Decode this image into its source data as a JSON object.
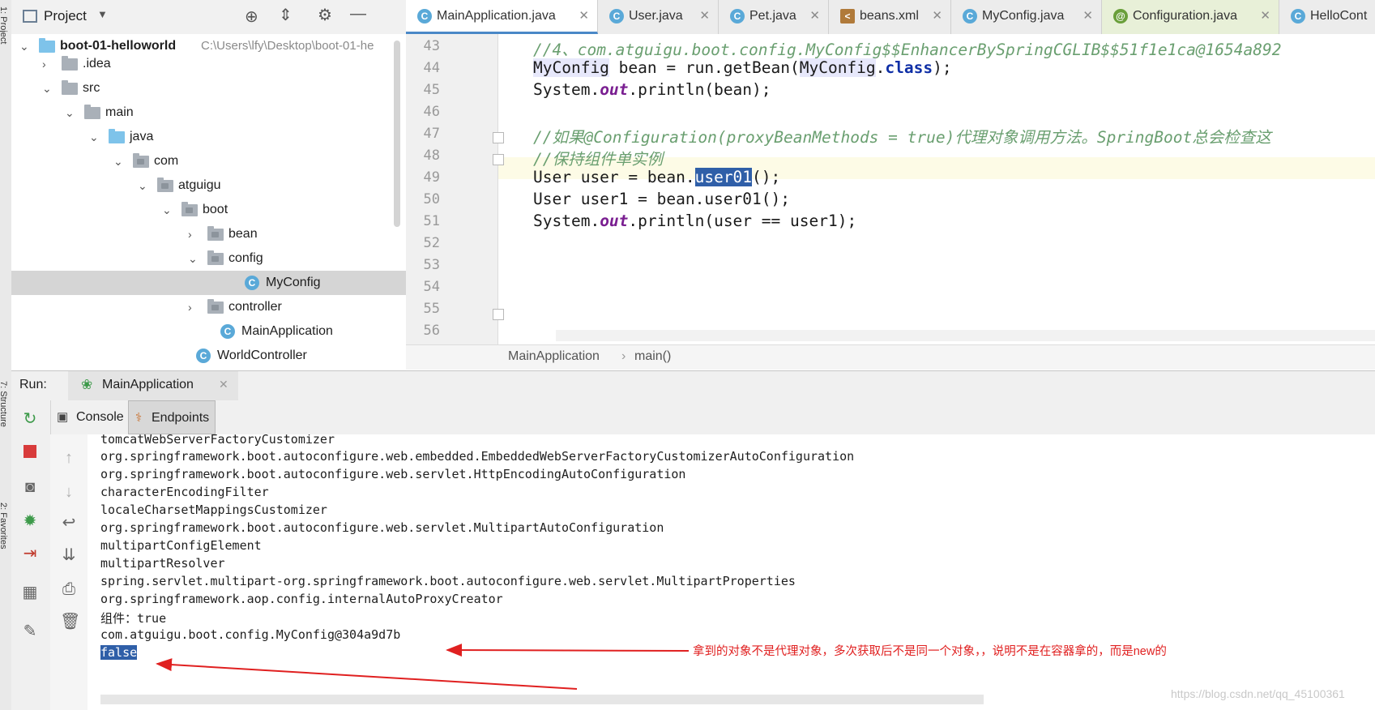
{
  "left_strip": {
    "labels": [
      "1: Project",
      "7: Structure",
      "2: Favorites"
    ]
  },
  "project_panel": {
    "title": "Project",
    "tree": [
      {
        "label": "boot-01-helloworld",
        "extra": "C:\\Users\\lfy\\Desktop\\boot-01-he",
        "bold": true,
        "level": 0,
        "arrow": "down",
        "icon": "module-folder"
      },
      {
        "label": ".idea",
        "level": 1,
        "arrow": "right",
        "icon": "folder"
      },
      {
        "label": "src",
        "level": 1,
        "arrow": "down",
        "icon": "folder"
      },
      {
        "label": "main",
        "level": 2,
        "arrow": "down",
        "icon": "folder"
      },
      {
        "label": "java",
        "level": 3,
        "arrow": "down",
        "icon": "source-folder"
      },
      {
        "label": "com",
        "level": 4,
        "arrow": "down",
        "icon": "package"
      },
      {
        "label": "atguigu",
        "level": 5,
        "arrow": "down",
        "icon": "package"
      },
      {
        "label": "boot",
        "level": 6,
        "arrow": "down",
        "icon": "package"
      },
      {
        "label": "bean",
        "level": 7,
        "arrow": "right",
        "icon": "package"
      },
      {
        "label": "config",
        "level": 7,
        "arrow": "down",
        "icon": "package"
      },
      {
        "label": "MyConfig",
        "level": 8,
        "arrow": "",
        "icon": "class",
        "selected": true
      },
      {
        "label": "controller",
        "level": 7,
        "arrow": "right",
        "icon": "package"
      },
      {
        "label": "MainApplication",
        "level": 7,
        "arrow": "",
        "icon": "spring-class"
      },
      {
        "label": "WorldController",
        "level": 6,
        "arrow": "",
        "icon": "class"
      }
    ]
  },
  "editor_tabs": [
    {
      "label": "MainApplication.java",
      "active": true,
      "icon": "spring-class-icon"
    },
    {
      "label": "User.java",
      "icon": "class-icon"
    },
    {
      "label": "Pet.java",
      "icon": "class-icon"
    },
    {
      "label": "beans.xml",
      "icon": "xml-icon"
    },
    {
      "label": "MyConfig.java",
      "icon": "class-icon"
    },
    {
      "label": "Configuration.java",
      "icon": "annotation-icon"
    },
    {
      "label": "HelloCont",
      "icon": "class-icon"
    }
  ],
  "editor": {
    "line_numbers": [
      "43",
      "44",
      "45",
      "46",
      "47",
      "48",
      "49",
      "50",
      "51",
      "52",
      "53",
      "54",
      "55",
      "56"
    ],
    "lines": {
      "l43": "//4、com.atguigu.boot.config.MyConfig$$EnhancerBySpringCGLIB$$51f1e1ca@1654a892",
      "l44a": "MyConfig",
      "l44b": " bean = run.getBean(",
      "l44c": "MyConfig",
      "l44d": ".",
      "l44e": "class",
      "l44f": ");",
      "l45a": "System.",
      "l45b": "out",
      "l45c": ".println(bean);",
      "l47": "//如果@Configuration(proxyBeanMethods = true)代理对象调用方法。SpringBoot总会检查这",
      "l48": "//保持组件单实例",
      "l49a": "User user = bean.",
      "l49b": "user01",
      "l49c": "();",
      "l50": "User user1 = bean.user01();",
      "l51a": "System.",
      "l51b": "out",
      "l51c": ".println(user == user1);"
    },
    "breadcrumb": [
      "MainApplication",
      "main()"
    ]
  },
  "run_panel": {
    "label": "Run:",
    "config": "MainApplication",
    "subtabs": [
      "Console",
      "Endpoints"
    ],
    "console_lines": [
      "tomcatWebServerFactoryCustomizer",
      "org.springframework.boot.autoconfigure.web.embedded.EmbeddedWebServerFactoryCustomizerAutoConfiguration",
      "org.springframework.boot.autoconfigure.web.servlet.HttpEncodingAutoConfiguration",
      "characterEncodingFilter",
      "localeCharsetMappingsCustomizer",
      "org.springframework.boot.autoconfigure.web.servlet.MultipartAutoConfiguration",
      "multipartConfigElement",
      "multipartResolver",
      "spring.servlet.multipart-org.springframework.boot.autoconfigure.web.servlet.MultipartProperties",
      "org.springframework.aop.config.internalAutoProxyCreator",
      "组件：true",
      "com.atguigu.boot.config.MyConfig@304a9d7b"
    ],
    "last_line": "false",
    "annotation": "拿到的对象不是代理对象，多次获取后不是同一个对象，，说明不是在容器拿的，而是new的"
  },
  "watermark": "https://blog.csdn.net/qq_45100361",
  "colors": {
    "accent": "#4a88c7",
    "selection": "#2f5fa8",
    "comment": "#6a9f70",
    "keyword": "#0f2fa6",
    "annotation_red": "#e02020",
    "run_green": "#3d9a4a",
    "stop_red": "#d83b3b"
  }
}
